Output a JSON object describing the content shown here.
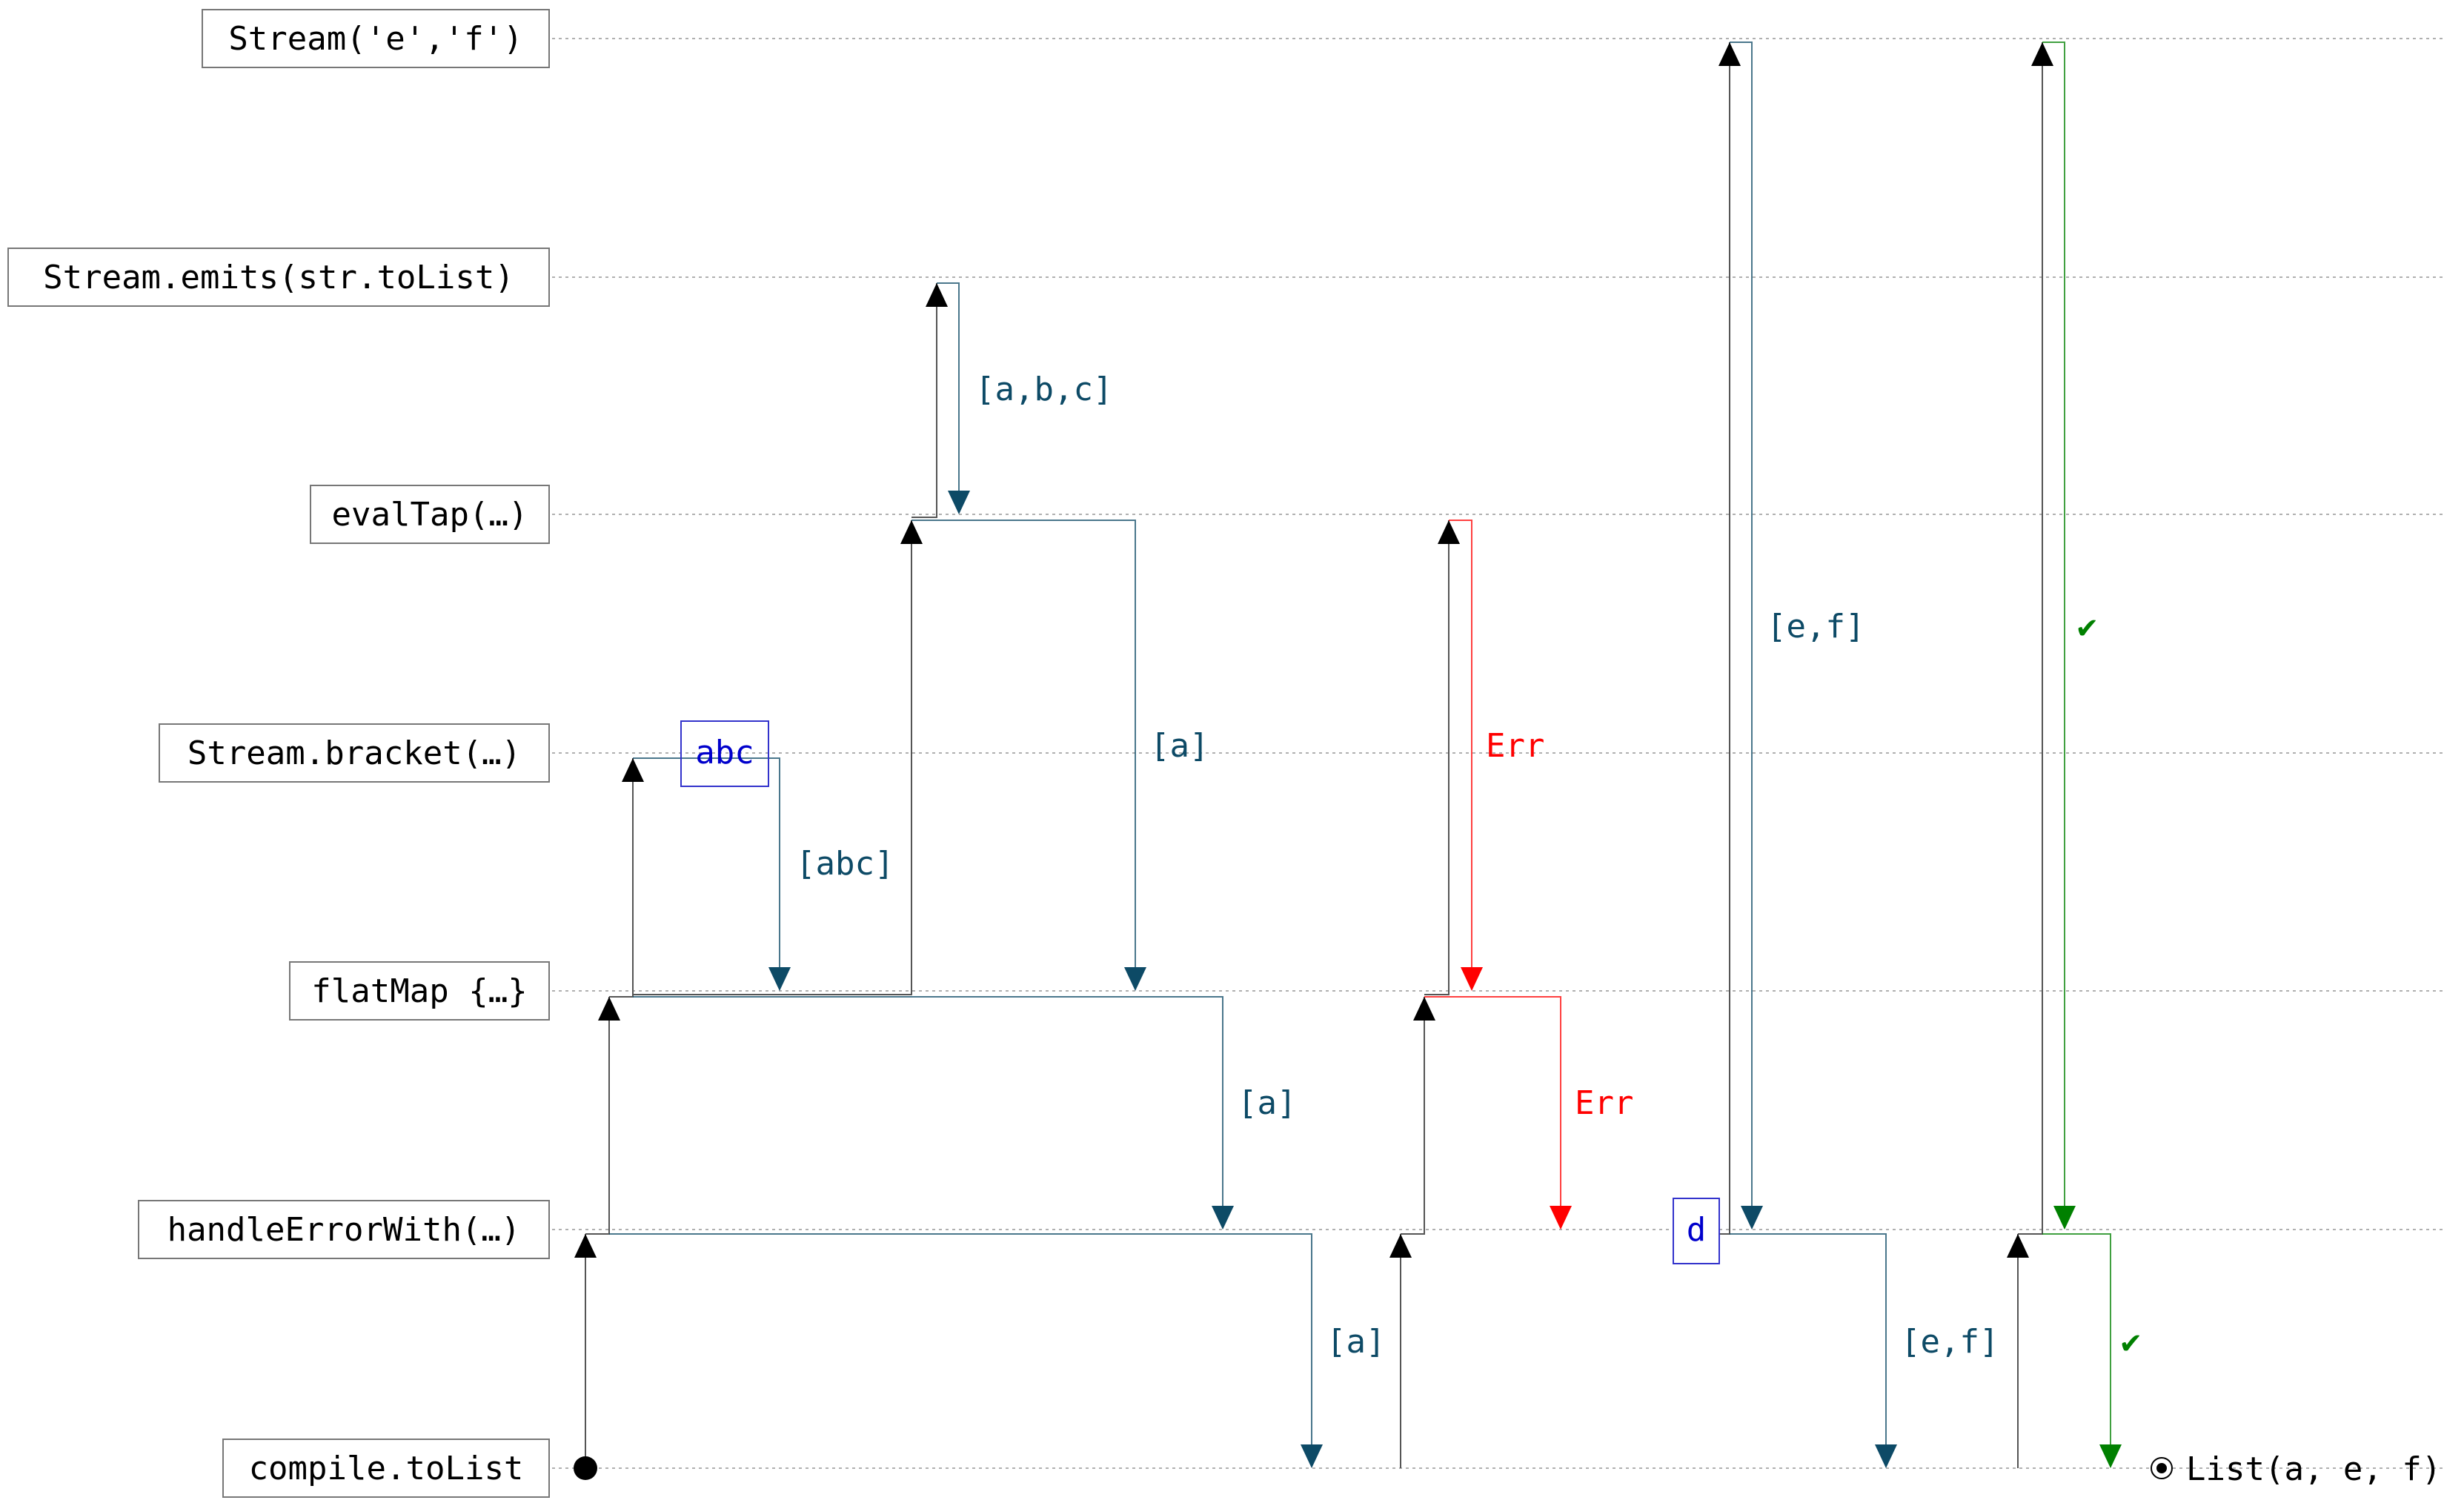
{
  "lanes": [
    {
      "label": "Stream('e','f')"
    },
    {
      "label": "Stream.emits(str.toList)"
    },
    {
      "label": "evalTap(…)"
    },
    {
      "label": "Stream.bracket(…)"
    },
    {
      "label": "flatMap {…}"
    },
    {
      "label": "handleErrorWith(…)"
    },
    {
      "label": "compile.toList"
    }
  ],
  "messages": {
    "emits_chunk": "[a,b,c]",
    "bracket_to_flatmap": "[abc]",
    "evaltap_to_flatmap": "[a]",
    "flatmap_to_handle": "[a]",
    "handle_to_compile_1": "[a]",
    "evaltap_error": "Err",
    "flatmap_error": "Err",
    "fallback_chunk": "[e,f]",
    "handle_to_compile_2": "[e,f]",
    "fallback_done": "✔",
    "handle_done": "✔"
  },
  "boxes": {
    "bracket_resource": "abc",
    "handler_value": "d"
  },
  "result": {
    "label": "List(a, e, f)"
  },
  "colors": {
    "data": "#0d4a66",
    "error": "#ff0000",
    "done": "#008000",
    "pull": "#000000",
    "box": "#0000cc",
    "guide": "#b0b0b0"
  }
}
